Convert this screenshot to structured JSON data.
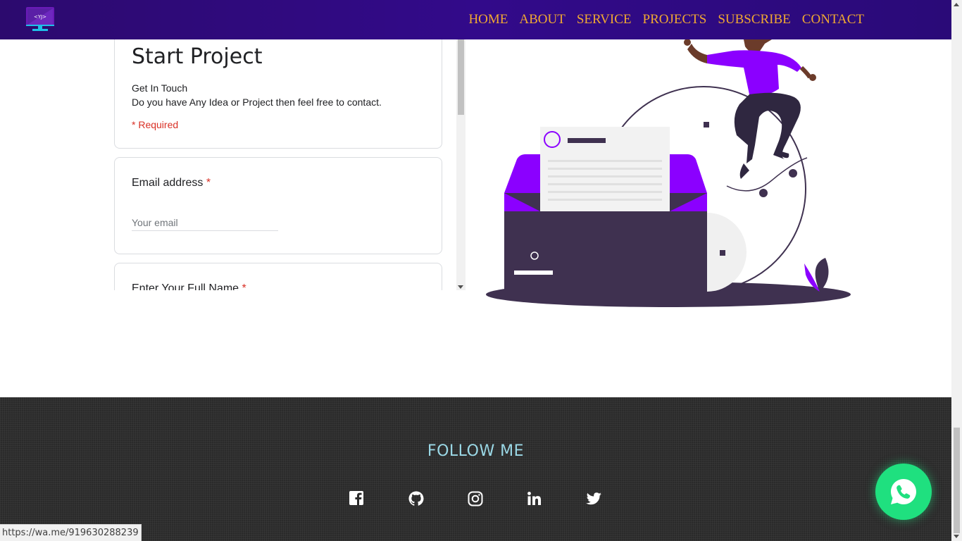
{
  "nav": {
    "logo_text": "<YJ>",
    "links": [
      "HOME",
      "ABOUT",
      "SERVICE",
      "PROJECTS",
      "SUBSCRIBE",
      "CONTACT"
    ]
  },
  "form": {
    "title": "Start Project",
    "subtitle_line1": "Get In Touch",
    "subtitle_line2": "Do you have Any Idea or Project then feel free to contact.",
    "required_note": "* Required",
    "email_label": "Email address",
    "email_placeholder": "Your email",
    "name_label": "Enter Your Full Name",
    "required_star": "*"
  },
  "footer": {
    "follow_title": "FOLLOW ME",
    "social_icons": [
      "facebook-icon",
      "github-icon",
      "instagram-icon",
      "linkedin-icon",
      "twitter-icon"
    ]
  },
  "whatsapp": {
    "icon": "whatsapp-phone-icon",
    "color": "#1fe07f"
  },
  "status_bar": {
    "url": "https://wa.me/919630288239"
  },
  "colors": {
    "nav_bg": "#320a8a",
    "nav_link": "#f0a832",
    "accent_purple": "#8b00ff",
    "dark_purple": "#3f3150",
    "footer_bg": "#2a2a2a",
    "follow_title": "#9ad8e6",
    "required_red": "#d93025"
  }
}
